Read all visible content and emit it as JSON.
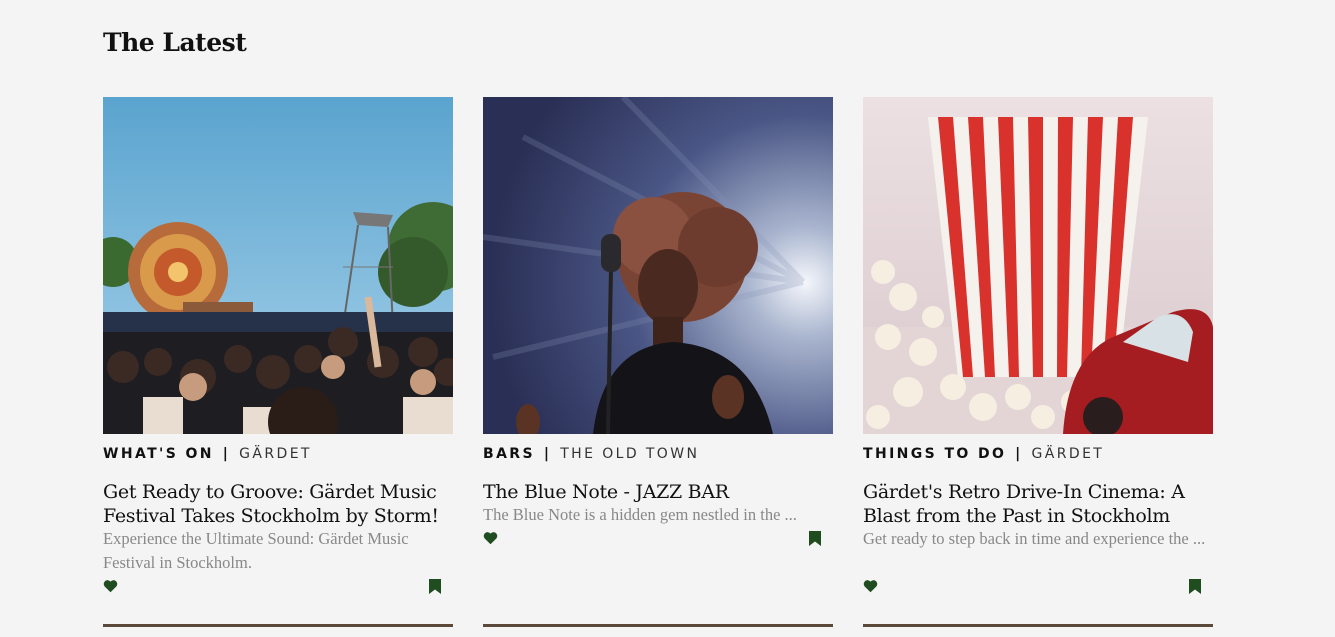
{
  "section": {
    "title": "The Latest"
  },
  "colors": {
    "icon": "#1f4d1f",
    "muted_text": "#888888"
  },
  "cards": [
    {
      "image": "festival-crowd-stage-photo",
      "category": "WHAT'S ON",
      "separator": "|",
      "location": "GÄRDET",
      "title": "Get Ready to Groove: Gärdet Music Festival Takes Stockholm by Storm!",
      "excerpt": "Experience the Ultimate Sound: Gärdet Music Festival in Stockholm.",
      "like_icon": "heart-icon",
      "save_icon": "bookmark-icon"
    },
    {
      "image": "jazz-singer-microphone-photo",
      "category": "BARS",
      "separator": "|",
      "location": "THE OLD TOWN",
      "title": "The Blue Note - JAZZ BAR",
      "excerpt": "The Blue Note is a hidden gem nestled in the ...",
      "like_icon": "heart-icon",
      "save_icon": "bookmark-icon"
    },
    {
      "image": "popcorn-toy-car-photo",
      "category": "THINGS TO DO",
      "separator": "|",
      "location": "GÄRDET",
      "title": "Gärdet's Retro Drive-In Cinema: A Blast from the Past in Stockholm",
      "excerpt": "Get ready to step back in time and experience the ...",
      "like_icon": "heart-icon",
      "save_icon": "bookmark-icon"
    }
  ]
}
